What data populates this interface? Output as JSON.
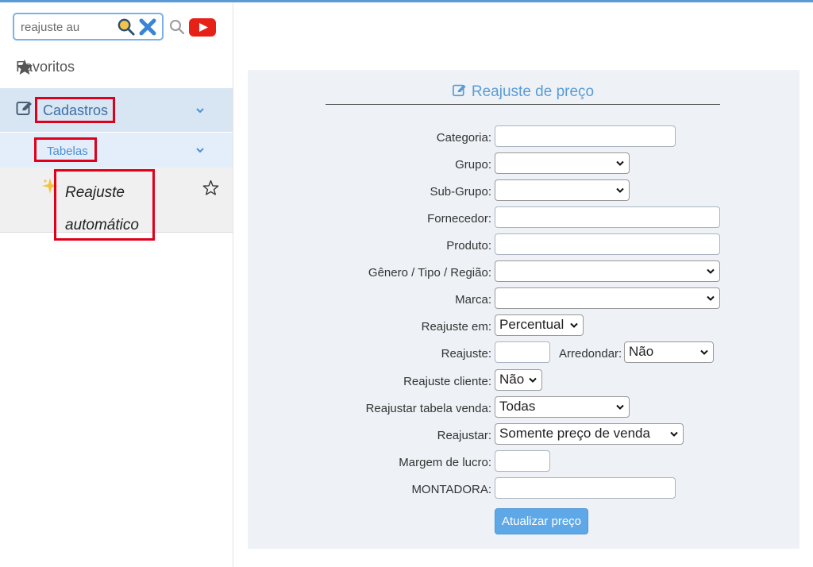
{
  "sidebar": {
    "search": {
      "value": "reajuste au",
      "placeholder": ""
    },
    "favorites_label": "Favoritos",
    "menu": {
      "cadastros_label": "Cadastros",
      "tabelas_label": "Tabelas",
      "reajuste_line1": "Reajuste",
      "reajuste_line2": "automático"
    },
    "icons": [
      "search-lens-icon",
      "clear-x-icon",
      "magnifier-icon",
      "youtube-icon",
      "star-icon",
      "edit-icon",
      "chevron-down-icon",
      "sparkle-icon",
      "star-outline-icon"
    ]
  },
  "form": {
    "title": "Reajuste de preço",
    "fields": {
      "categoria": {
        "label": "Categoria:",
        "value": ""
      },
      "grupo": {
        "label": "Grupo:",
        "value": ""
      },
      "subgrupo": {
        "label": "Sub-Grupo:",
        "value": ""
      },
      "fornecedor": {
        "label": "Fornecedor:",
        "value": ""
      },
      "produto": {
        "label": "Produto:",
        "value": ""
      },
      "genero": {
        "label": "Gênero / Tipo / Região:",
        "value": ""
      },
      "marca": {
        "label": "Marca:",
        "value": ""
      },
      "reajuste_em": {
        "label": "Reajuste em:",
        "value": "Percentual"
      },
      "reajuste": {
        "label": "Reajuste:",
        "value": ""
      },
      "arredondar": {
        "label": "Arredondar:",
        "value": "Não"
      },
      "reajuste_cliente": {
        "label": "Reajuste cliente:",
        "value": "Não"
      },
      "reajustar_tabela": {
        "label": "Reajustar tabela venda:",
        "value": "Todas"
      },
      "reajustar": {
        "label": "Reajustar:",
        "value": "Somente preço de venda"
      },
      "margem": {
        "label": "Margem de lucro:",
        "value": ""
      },
      "montadora": {
        "label": "MONTADORA:",
        "value": ""
      }
    },
    "submit_label": "Atualizar preço"
  },
  "colors": {
    "accent": "#5b9bd5",
    "highlight_border": "#e0001b",
    "menu_active_bg": "#d8e6f4",
    "panel_bg": "#eef2f6",
    "button_bg": "#5fa8e8"
  }
}
